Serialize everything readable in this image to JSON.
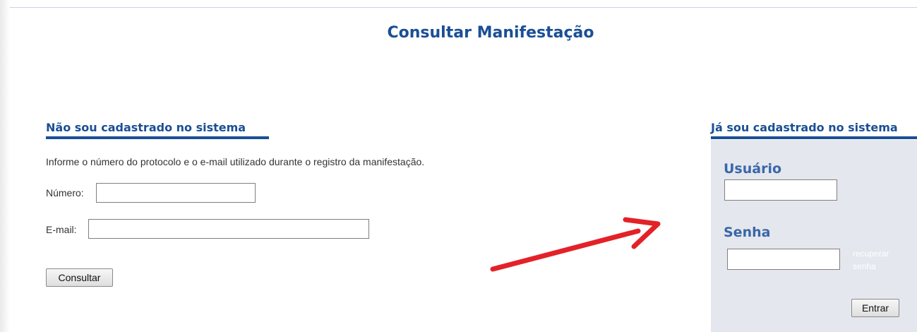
{
  "page": {
    "title": "Consultar Manifestação"
  },
  "guest": {
    "heading": "Não sou cadastrado no sistema",
    "instructions": "Informe o número do protocolo e o e-mail utilizado durante o registro da manifestação.",
    "numero_label": "Número:",
    "numero_value": "",
    "email_label": "E-mail:",
    "email_value": "",
    "submit_label": "Consultar"
  },
  "member": {
    "heading": "Já sou cadastrado no sistema",
    "usuario_label": "Usuário",
    "usuario_value": "",
    "senha_label": "Senha",
    "senha_value": "",
    "recover_link": "recuperar senha",
    "submit_label": "Entrar"
  },
  "colors": {
    "heading_blue": "#1a4f95",
    "panel_label_blue": "#3a66a8",
    "panel_bg": "#e4e7ed",
    "annotation_arrow": "#e32228"
  },
  "annotation": {
    "icon": "red-arrow-icon",
    "points_to": "login-panel"
  }
}
